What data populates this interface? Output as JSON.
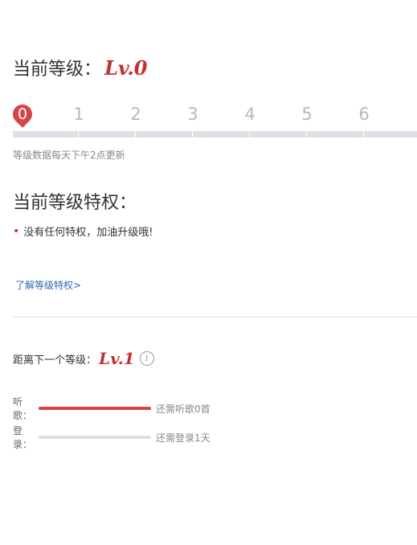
{
  "header": {
    "current_level_label": "当前等级：",
    "current_level_badge": "Lv.0"
  },
  "level_track": {
    "current_level": 0,
    "current_label": "0",
    "levels": [
      "1",
      "2",
      "3",
      "4",
      "5",
      "6"
    ]
  },
  "update_note": "等级数据每天下午2点更新",
  "privileges": {
    "title": "当前等级特权：",
    "items": [
      "没有任何特权，加油升级哦!"
    ]
  },
  "learn_link": "了解等级特权>",
  "next_level": {
    "label": "距离下一个等级：",
    "badge": "Lv.1",
    "info_icon": "i"
  },
  "progress": [
    {
      "label": "听歌：",
      "fraction": 1.0,
      "note": "还需听歌0首"
    },
    {
      "label": "登录：",
      "fraction": 0.0,
      "note": "还需登录1天"
    }
  ],
  "colors": {
    "accent": "#c62f2f",
    "pin": "#d64545",
    "track": "#dde1e6",
    "link": "#2b6ab5"
  }
}
